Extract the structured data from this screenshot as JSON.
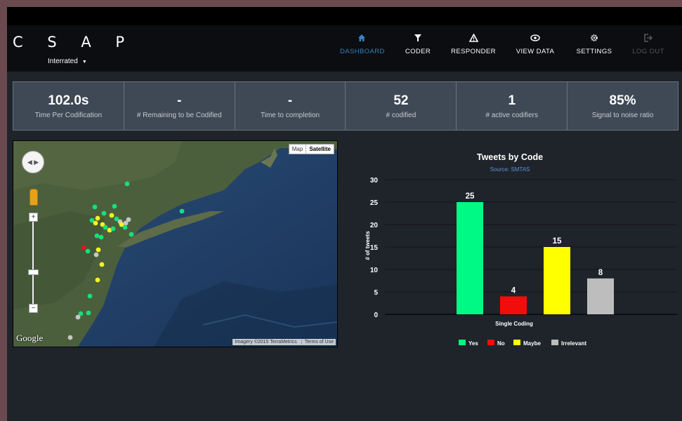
{
  "brand": "C S A P",
  "project": {
    "name": "Interrated"
  },
  "nav": [
    {
      "label": "DASHBOARD",
      "icon": "home-icon",
      "active": true
    },
    {
      "label": "CODER",
      "icon": "funnel-icon"
    },
    {
      "label": "RESPONDER",
      "icon": "warning-icon"
    },
    {
      "label": "VIEW DATA",
      "icon": "eye-icon"
    },
    {
      "label": "SETTINGS",
      "icon": "gear-icon"
    },
    {
      "label": "LOG OUT",
      "icon": "logout-icon",
      "disabled": true
    }
  ],
  "stats": [
    {
      "value": "102.0s",
      "label": "Time Per Codification"
    },
    {
      "value": "-",
      "label": "# Remaining to be Codified"
    },
    {
      "value": "-",
      "label": "Time to completion"
    },
    {
      "value": "52",
      "label": "# codified"
    },
    {
      "value": "1",
      "label": "# active codifiers"
    },
    {
      "value": "85%",
      "label": "Signal to noise ratio"
    }
  ],
  "map": {
    "type_buttons": [
      "Map",
      "Satellite"
    ],
    "selected_type": "Satellite",
    "logo": "Google",
    "imagery": "Imagery ©2015 TerraMetrics",
    "terms": "Terms of Use",
    "marker_colors": {
      "Yes": "#16e07a",
      "No": "#e8141b",
      "Maybe": "#f5f51b",
      "Irrelevant": "#c6c6c6"
    }
  },
  "chart_data": {
    "type": "bar",
    "title": "Tweets by Code",
    "subtitle": "Source: SMTAS",
    "xlabel": "Single Coding",
    "ylabel": "# of tweets",
    "ylim": [
      0,
      30
    ],
    "yticks": [
      0,
      5,
      10,
      15,
      20,
      25,
      30
    ],
    "series": [
      {
        "name": "Yes",
        "value": 25,
        "color": "#00f884"
      },
      {
        "name": "No",
        "value": 4,
        "color": "#f20d0d"
      },
      {
        "name": "Maybe",
        "value": 15,
        "color": "#ffff00"
      },
      {
        "name": "Irrelevant",
        "value": 8,
        "color": "#bdbdbd"
      }
    ],
    "legend_position": "bottom",
    "grid": true
  }
}
